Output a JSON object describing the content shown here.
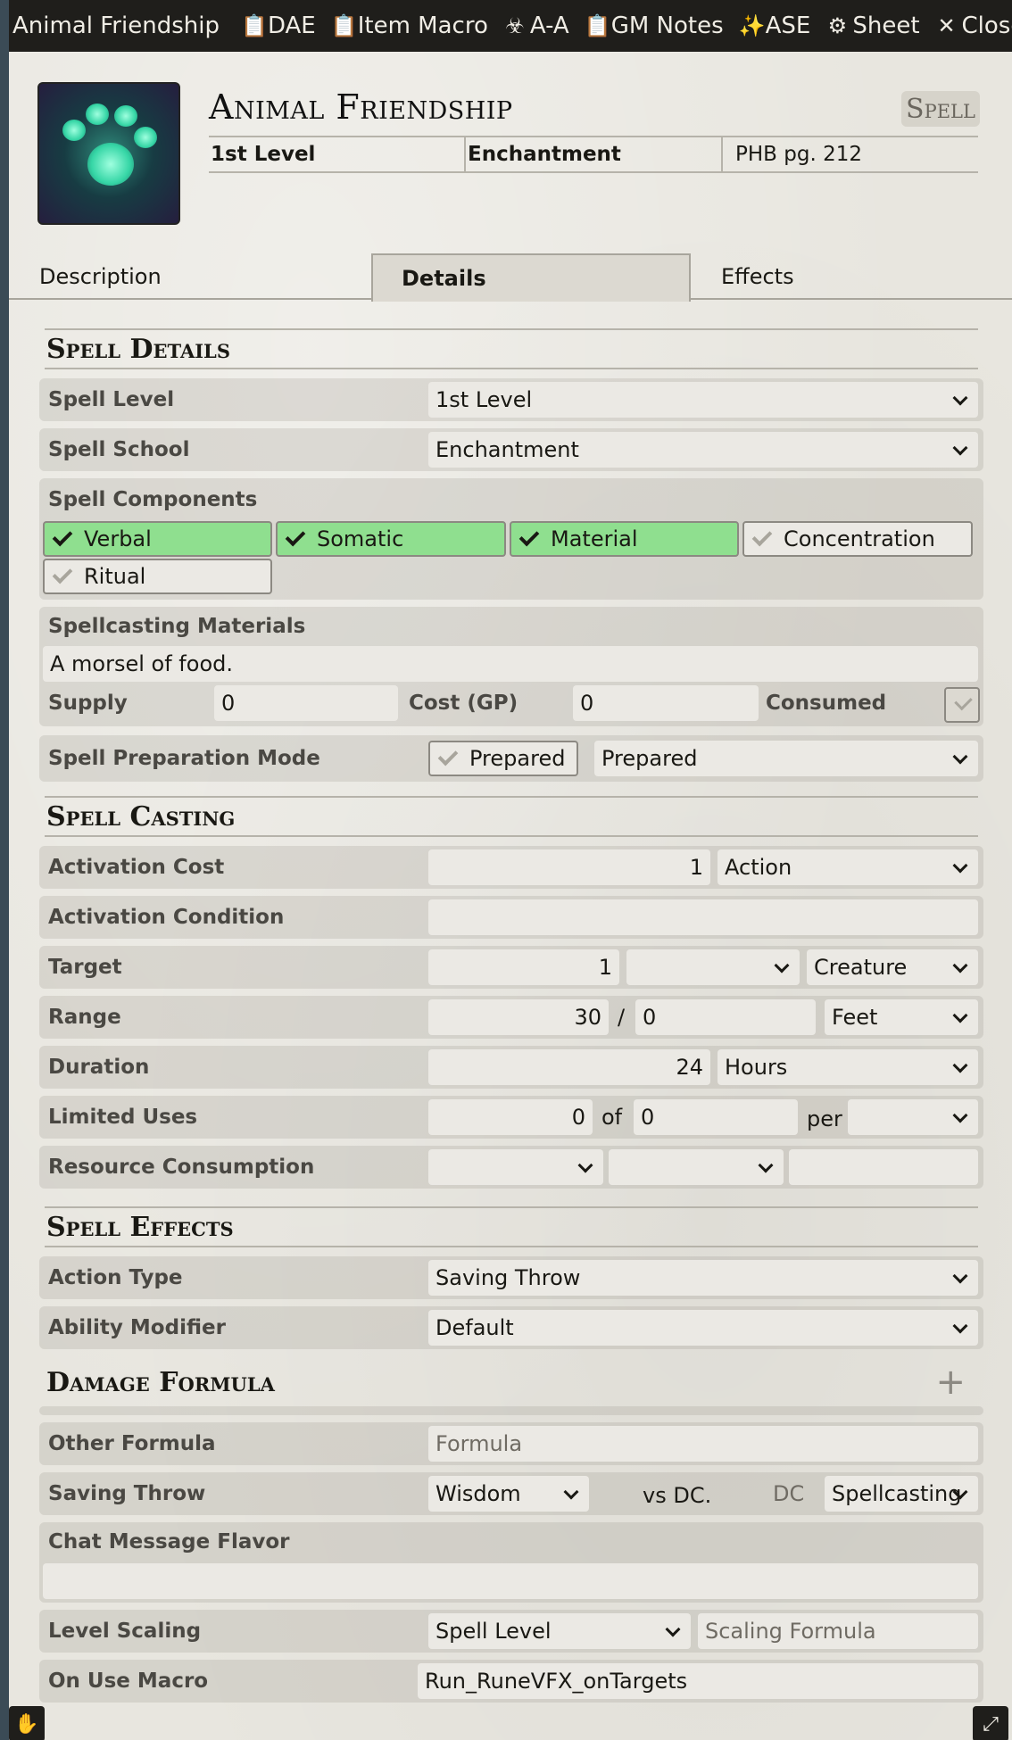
{
  "titlebar": {
    "title": "Animal Friendship",
    "buttons": [
      {
        "label": "DAE",
        "icon": "clipboard-icon"
      },
      {
        "label": "Item Macro",
        "icon": "clipboard-icon"
      },
      {
        "label": "A-A",
        "icon": "biohazard-icon"
      },
      {
        "label": "GM Notes",
        "icon": "clipboard-icon"
      },
      {
        "label": "ASE",
        "icon": "magic-wand-icon"
      },
      {
        "label": "Sheet",
        "icon": "gear-icon"
      },
      {
        "label": "Close",
        "icon": "close-icon"
      }
    ]
  },
  "header": {
    "name": "Animal Friendship",
    "item_type": "Spell",
    "level": "1st Level",
    "school": "Enchantment",
    "source": "PHB pg. 212"
  },
  "tabs": [
    "Description",
    "Details",
    "Effects"
  ],
  "active_tab": "Details",
  "spell_details": {
    "title": "Spell Details",
    "spell_level_label": "Spell Level",
    "spell_level_value": "1st Level",
    "spell_school_label": "Spell School",
    "spell_school_value": "Enchantment",
    "components_label": "Spell Components",
    "components": [
      {
        "label": "Verbal",
        "checked": true
      },
      {
        "label": "Somatic",
        "checked": true
      },
      {
        "label": "Material",
        "checked": true
      },
      {
        "label": "Concentration",
        "checked": false
      },
      {
        "label": "Ritual",
        "checked": false
      }
    ],
    "materials_label": "Spellcasting Materials",
    "materials_value": "A morsel of food.",
    "supply_label": "Supply",
    "supply_value": "0",
    "cost_label": "Cost (GP)",
    "cost_value": "0",
    "consumed_label": "Consumed",
    "prep_label": "Spell Preparation Mode",
    "prep_checkbox_label": "Prepared",
    "prep_value": "Prepared"
  },
  "spell_casting": {
    "title": "Spell Casting",
    "activation_cost_label": "Activation Cost",
    "activation_cost_value": "1",
    "activation_type": "Action",
    "activation_condition_label": "Activation Condition",
    "activation_condition_value": "",
    "target_label": "Target",
    "target_value": "1",
    "target_unit": "",
    "target_type": "Creature",
    "range_label": "Range",
    "range_value": "30",
    "range_sep": "/",
    "range_long": "0",
    "range_unit": "Feet",
    "duration_label": "Duration",
    "duration_value": "24",
    "duration_unit": "Hours",
    "limited_uses_label": "Limited Uses",
    "uses_value": "0",
    "uses_of": "of",
    "uses_max": "0",
    "uses_per": "per",
    "uses_period": "",
    "resource_label": "Resource Consumption"
  },
  "spell_effects": {
    "title": "Spell Effects",
    "action_type_label": "Action Type",
    "action_type_value": "Saving Throw",
    "ability_mod_label": "Ability Modifier",
    "ability_mod_value": "Default",
    "damage_title": "Damage Formula",
    "other_formula_label": "Other Formula",
    "other_formula_placeholder": "Formula",
    "saving_throw_label": "Saving Throw",
    "saving_throw_ability": "Wisdom",
    "vs_dc": "vs DC.",
    "dc_placeholder": "DC",
    "dc_scaling": "Spellcasting",
    "chat_flavor_label": "Chat Message Flavor",
    "level_scaling_label": "Level Scaling",
    "level_scaling_value": "Spell Level",
    "scaling_formula_placeholder": "Scaling Formula",
    "on_use_macro_label": "On Use Macro",
    "on_use_macro_value": "Run_RuneVFX_onTargets"
  },
  "colors": {
    "titlebar_bg": "#1f1e1b",
    "checked_green": "#8fdf8f",
    "sheet_bg": "#e8e6df"
  }
}
